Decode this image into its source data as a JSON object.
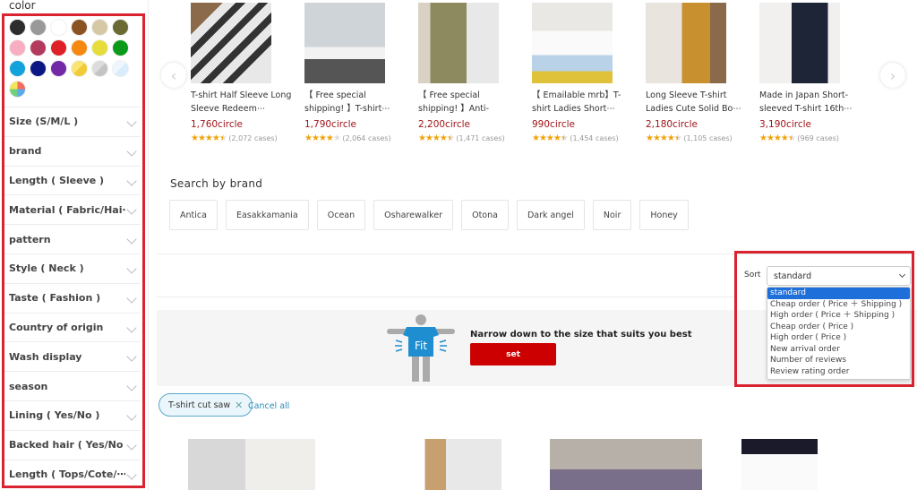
{
  "sidebar": {
    "color_title": "color",
    "colors": [
      {
        "name": "black",
        "hex": "#2d2d2d"
      },
      {
        "name": "gray",
        "hex": "#999999"
      },
      {
        "name": "white",
        "hex": "#ffffff"
      },
      {
        "name": "brown",
        "hex": "#8b5222"
      },
      {
        "name": "beige",
        "hex": "#d6c8a4"
      },
      {
        "name": "khaki",
        "hex": "#6b6a34"
      },
      {
        "name": "pink",
        "hex": "#f7aec0"
      },
      {
        "name": "wine",
        "hex": "#b33a5d"
      },
      {
        "name": "red",
        "hex": "#dd2127"
      },
      {
        "name": "orange",
        "hex": "#f6870f"
      },
      {
        "name": "yellow",
        "hex": "#e7dd3a"
      },
      {
        "name": "green",
        "hex": "#0a9a1b"
      },
      {
        "name": "blue",
        "hex": "#12a2dc"
      },
      {
        "name": "navy",
        "hex": "#0b1783"
      },
      {
        "name": "purple",
        "hex": "#7329a6"
      },
      {
        "name": "gold",
        "hex": "linear-gradient(135deg,#fbe372 50%,#f1cb35 50%)"
      },
      {
        "name": "silver",
        "hex": "linear-gradient(135deg,#dcdcdc 50%,#c4c4c4 50%)"
      },
      {
        "name": "clear",
        "hex": "linear-gradient(135deg,#eef7ff 50%,#d8ecfb 50%)"
      },
      {
        "name": "multi",
        "hex": "conic-gradient(#f46d5b 0 25%,#5fa8f0 0 50%,#6fd07a 0 75%,#f4e45a 0 100%)"
      }
    ],
    "filters": [
      "Size (S/M/L )",
      "brand",
      "Length ( Sleeve )",
      "Material ( Fabric/Hai⋯",
      "pattern",
      "Style ( Neck )",
      "Taste ( Fashion )",
      "Country of origin",
      "Wash display",
      "season",
      "Lining ( Yes/No )",
      "Backed hair ( Yes/No )",
      "Length ( Tops/Cote/⋯"
    ]
  },
  "carousel": {
    "prev_icon": "‹",
    "next_icon": "›",
    "products": [
      {
        "name": "T-shirt Half Sleeve Long Sleeve Redeem⋯",
        "price": "1,760circle",
        "stars": 4.5,
        "reviews": "(2,072 cases)",
        "img": "linear-gradient(135deg,#8a6a4a 0 20%,#e8e8e8 20% 28%,#333 28% 34%,#e8e8e8 34% 42%,#333 42% 48%,#e8e8e8 48% 56%,#333 56% 62%,#e8e8e8 62% 70%,#333 70% 76%,#e8e8e8 76%)"
      },
      {
        "name": "【 Free special shipping! 】T-shirt⋯",
        "price": "1,790circle",
        "stars": 4,
        "reviews": "(2,064 cases)",
        "img": "linear-gradient(180deg,#cfd4d8 0 55%,#f2f2f2 55% 70%,#555 70%)"
      },
      {
        "name": "【 Free special shipping! 】Anti-swear⋯",
        "price": "2,200circle",
        "stars": 4.5,
        "reviews": "(1,471 cases)",
        "img": "linear-gradient(90deg,#d9d2c4 0 15%,#8c8a5e 15% 60%,#e8e8e8 60%)"
      },
      {
        "name": "【 Emailable mrb】T-shirt Ladies Short⋯",
        "price": "990circle",
        "stars": 4.5,
        "reviews": "(1,454 cases)",
        "img": "linear-gradient(180deg,#eae8e4 0 35%,#fafafa 35% 65%,#b9d2e8 65% 85%,#e0c23a 85%)"
      },
      {
        "name": "Long Sleeve T-shirt Ladies Cute Solid Bo⋯",
        "price": "2,180circle",
        "stars": 4.5,
        "reviews": "(1,105 cases)",
        "img": "linear-gradient(90deg,#e9e4de 0 45%,#c8902f 45% 80%,#8a6a4a 80%)"
      },
      {
        "name": "Made in Japan Short-sleeved T-shirt 16th⋯",
        "price": "3,190circle",
        "stars": 4.5,
        "reviews": "(969 cases)",
        "img": "linear-gradient(90deg,#f1f0ee 0 40%,#1d2536 40% 85%,#f1f0ee 85%)"
      }
    ]
  },
  "brand_section": {
    "title": "Search by brand",
    "brands": [
      "Antica",
      "Easakkamania",
      "Ocean",
      "Osharewalker",
      "Otona",
      "Dark angel",
      "Noir",
      "Honey"
    ]
  },
  "sort": {
    "label": "Sort",
    "selected": "standard",
    "options": [
      "standard",
      "Cheap order ( Price ＋ Shipping )",
      "High order ( Price ＋ Shipping )",
      "Cheap order ( Price )",
      "High order ( Price )",
      "New arrival order",
      "Number of reviews",
      "Review rating order"
    ]
  },
  "fit_banner": {
    "badge": "Fit",
    "text": "Narrow down to the size that suits you best",
    "button": "set"
  },
  "active_filters": {
    "chip": "T-shirt cut saw",
    "chip_close": "✕",
    "cancel_all": "Cancel all"
  },
  "bottom_products": [
    {
      "img": "linear-gradient(90deg,#d8d8d8 0 45%,#f0eeea 45%)"
    },
    {
      "img": "linear-gradient(90deg,#fff 0 45%,#c8a070 45% 60%,#e8e8e8 60%)"
    },
    {
      "img": "linear-gradient(180deg,#b7b0a8 0 60%,#7a6f8a 60%)"
    },
    {
      "img": "linear-gradient(180deg,#1a1a2a 0 30%,#fafafa 30%)"
    }
  ],
  "colors": {
    "accent_red": "#d9232e",
    "price_red": "#a0151a",
    "button_red": "#cc0000",
    "link_blue": "#2a8cb8",
    "select_blue": "#1e6fd9"
  }
}
